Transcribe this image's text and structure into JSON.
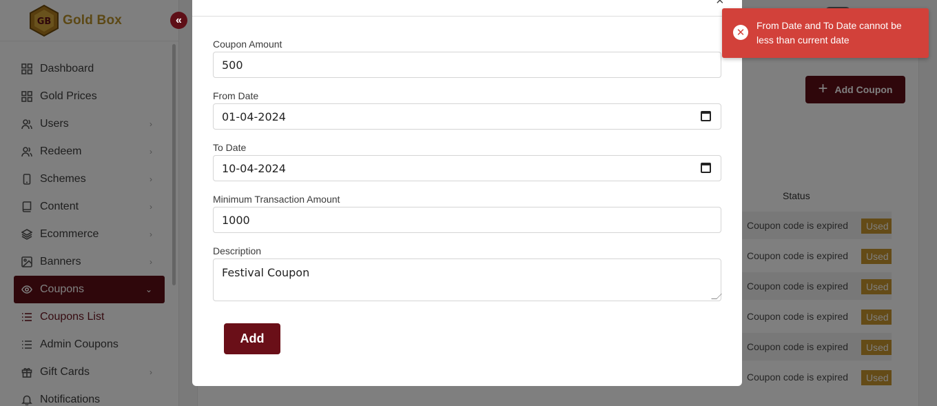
{
  "app": {
    "brand_name": "Gold Box",
    "brand_color": "#b8902a",
    "accent_color": "#5e0f17",
    "logo_letters": "GB"
  },
  "sidebar": {
    "collapse_icon": "double-chevron-left-icon",
    "items": [
      {
        "label": "Dashboard",
        "icon": "grid-icon",
        "has_submenu": false
      },
      {
        "label": "Gold Prices",
        "icon": "grid-icon",
        "has_submenu": false
      },
      {
        "label": "Users",
        "icon": "users-icon",
        "has_submenu": true
      },
      {
        "label": "Redeem",
        "icon": "users-icon",
        "has_submenu": true
      },
      {
        "label": "Schemes",
        "icon": "phone-icon",
        "has_submenu": true
      },
      {
        "label": "Content",
        "icon": "book-icon",
        "has_submenu": true
      },
      {
        "label": "Ecommerce",
        "icon": "layers-icon",
        "has_submenu": true
      },
      {
        "label": "Banners",
        "icon": "image-icon",
        "has_submenu": true
      },
      {
        "label": "Coupons",
        "icon": "eye-icon",
        "has_submenu": true,
        "active": true,
        "expanded": true
      },
      {
        "label": "Coupons List",
        "icon": "list-icon",
        "has_submenu": false,
        "sub_active": true
      },
      {
        "label": "Admin Coupons",
        "icon": "list-icon",
        "has_submenu": false
      },
      {
        "label": "Gift Cards",
        "icon": "gift-icon",
        "has_submenu": true
      },
      {
        "label": "Notifications",
        "icon": "bell-icon",
        "has_submenu": false
      }
    ]
  },
  "background_page": {
    "add_coupon_label": "Add Coupon",
    "status_header": "Status",
    "rows": [
      {
        "message": "Coupon code is expired",
        "badge": "Used"
      },
      {
        "message": "Coupon code is expired",
        "badge": "Used"
      },
      {
        "message": "Coupon code is expired",
        "badge": "Used"
      },
      {
        "message": "Coupon code is expired",
        "badge": "Used"
      },
      {
        "message": "Coupon code is expired",
        "badge": "Used"
      },
      {
        "message": "Coupon code is expired",
        "badge": "Used"
      }
    ]
  },
  "modal": {
    "close_icon": "close-icon",
    "fields": {
      "coupon_amount": {
        "label": "Coupon Amount",
        "value": "500"
      },
      "from_date": {
        "label": "From Date",
        "value": "01-04-2024"
      },
      "to_date": {
        "label": "To Date",
        "value": "10-04-2024"
      },
      "min_transaction": {
        "label": "Minimum Transaction Amount",
        "value": "1000"
      },
      "description": {
        "label": "Description",
        "value": "Festival Coupon"
      }
    },
    "submit_label": "Add"
  },
  "toast": {
    "icon": "error-circle-icon",
    "message": "From Date and To Date cannot be less than current date",
    "color": "#d2413a"
  }
}
